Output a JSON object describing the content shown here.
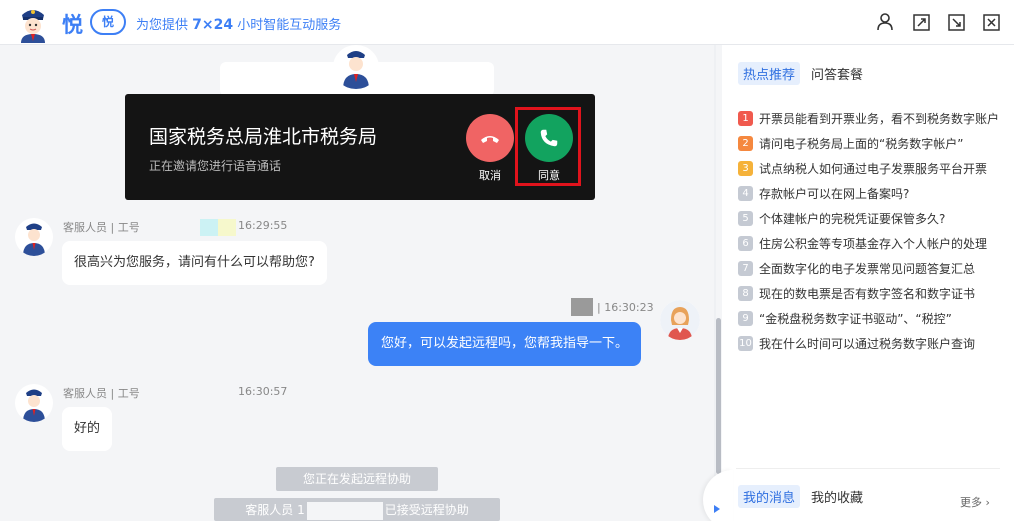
{
  "header": {
    "logo_text": "悦",
    "logo_badge": "悦",
    "subtitle_prefix": "为您提供 ",
    "subtitle_highlight": "7×24",
    "subtitle_suffix": " 小时智能互动服务",
    "icons": [
      "user-icon",
      "expand-icon",
      "exit-fullscreen-icon",
      "close-icon"
    ]
  },
  "call": {
    "title": "国家税务总局淮北市税务局",
    "subtitle": "正在邀请您进行语音通话",
    "decline_label": "取消",
    "accept_label": "同意"
  },
  "messages": [
    {
      "sender": "agent",
      "meta": "客服人员 | 工号",
      "time": "16:29:55",
      "text": "很高兴为您服务，请问有什么可以帮助您?"
    },
    {
      "sender": "user",
      "time": "| 16:30:23",
      "text": "您好，可以发起远程吗，您帮我指导一下。"
    },
    {
      "sender": "agent",
      "meta": "客服人员 | 工号",
      "time": "16:30:57",
      "text": "好的"
    }
  ],
  "system": {
    "notice1": "您正在发起远程协助",
    "notice2_prefix": "客服人员 1",
    "notice2_suffix": "已接受远程协助"
  },
  "sidebar": {
    "tabs": [
      "热点推荐",
      "问答套餐"
    ],
    "hot_items": [
      {
        "rank": "1",
        "text": "开票员能看到开票业务，看不到税务数字账户"
      },
      {
        "rank": "2",
        "text": "请问电子税务局上面的“税务数字帐户”"
      },
      {
        "rank": "3",
        "text": "试点纳税人如何通过电子发票服务平台开票"
      },
      {
        "rank": "4",
        "text": "存款帐户可以在网上备案吗?"
      },
      {
        "rank": "5",
        "text": "个体建帐户的完税凭证要保管多久?"
      },
      {
        "rank": "6",
        "text": "住房公积金等专项基金存入个人帐户的处理"
      },
      {
        "rank": "7",
        "text": "全面数字化的电子发票常见问题答复汇总"
      },
      {
        "rank": "8",
        "text": "现在的数电票是否有数字签名和数字证书"
      },
      {
        "rank": "9",
        "text": "“金税盘税务数字证书驱动”、“税控”"
      },
      {
        "rank": "10",
        "text": "我在什么时间可以通过税务数字账户查询"
      }
    ],
    "rank_colors": [
      "#f05a4e",
      "#f5883f",
      "#f5b23a",
      "#c5cad3"
    ],
    "bottom_tabs": [
      "我的消息",
      "我的收藏"
    ],
    "more_label": "更多"
  },
  "colors": {
    "accent": "#3d7ff5",
    "accept": "#12a35f",
    "decline": "#f06464",
    "highlight": "#e0131c"
  }
}
